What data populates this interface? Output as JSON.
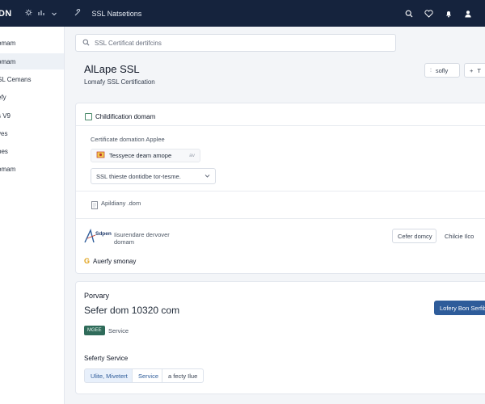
{
  "topbar": {
    "brand": "DN",
    "title": "SSL Natsetions"
  },
  "sidebar": {
    "items": [
      {
        "label": "omam"
      },
      {
        "label": "omam"
      },
      {
        "label": "SL Cemans"
      },
      {
        "label": "efy"
      },
      {
        "label": "s V9"
      },
      {
        "label": "ves"
      },
      {
        "label": "pes"
      },
      {
        "label": "omam"
      }
    ],
    "active_index": 1
  },
  "search": {
    "placeholder": "SSL Certificat dertifcins"
  },
  "header": {
    "title": "AlLape SSL",
    "subtitle": "Lomafy SSL Certification",
    "btn_sofy": "sofly",
    "btn_add": "T"
  },
  "card1": {
    "heading": "Childification domam",
    "section_label": "Certificate domation Applee",
    "chip_text": "Tessyece deam amope",
    "chip_tail": "av",
    "select_value": "SSL thieste dontidbe tor-tesme.",
    "checkbox_label": "Apildiany .dom",
    "provider_logo": "Sdpen",
    "provider_line1": "Iisurendare dervover",
    "provider_line2": "domam",
    "btn_defer": "Cefer domcy",
    "btn_choose": "Chilcie Ilco",
    "footer_label": "Auerfy smonay"
  },
  "card2": {
    "heading": "Porvary",
    "value": "Sefer dom 10320 com",
    "primary_btn": "Lofery Bon Serfibe",
    "badge": "MGEE",
    "badge_label": "Service",
    "section2": "Seferty Service",
    "seg1": "Ulite, Mivetert",
    "seg2": "Service",
    "seg3": "a fecty Ilue"
  },
  "colors": {
    "topbar": "#15233d",
    "primary": "#2e5c9a",
    "badge": "#2f6b5a"
  }
}
